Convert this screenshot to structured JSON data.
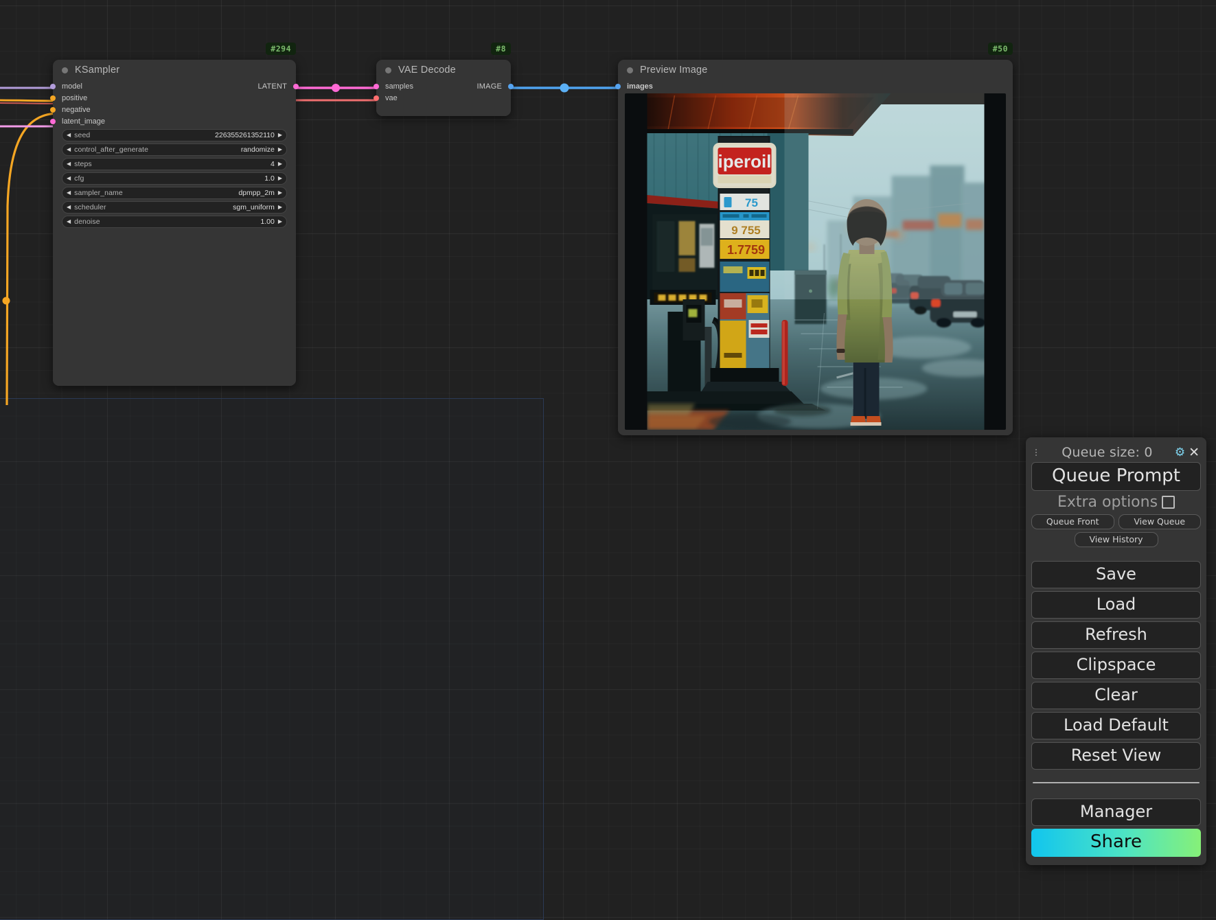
{
  "app": {
    "name": "ComfyUI",
    "canvas_bg": "#212121"
  },
  "nodes": [
    {
      "id": "ksampler",
      "badge": "#294",
      "title": "KSampler",
      "inputs": [
        {
          "label": "model",
          "color": "#b39ddb"
        },
        {
          "label": "positive",
          "color": "#f5a623"
        },
        {
          "label": "negative",
          "color": "#f5a623"
        },
        {
          "label": "latent_image",
          "color": "#ff6ad5"
        }
      ],
      "outputs": [
        {
          "label": "LATENT",
          "color": "#ff6ad5"
        }
      ],
      "widgets": [
        {
          "name": "seed",
          "value": "226355261352110"
        },
        {
          "name": "control_after_generate",
          "value": "randomize"
        },
        {
          "name": "steps",
          "value": "4"
        },
        {
          "name": "cfg",
          "value": "1.0"
        },
        {
          "name": "sampler_name",
          "value": "dpmpp_2m"
        },
        {
          "name": "scheduler",
          "value": "sgm_uniform"
        },
        {
          "name": "denoise",
          "value": "1.00"
        }
      ]
    },
    {
      "id": "vaedecode",
      "badge": "#8",
      "title": "VAE Decode",
      "inputs": [
        {
          "label": "samples",
          "color": "#ff6ad5"
        },
        {
          "label": "vae",
          "color": "#ff6f6f"
        }
      ],
      "outputs": [
        {
          "label": "IMAGE",
          "color": "#56a3ef"
        }
      ],
      "widgets": []
    },
    {
      "id": "previewimage",
      "badge": "#50",
      "title": "Preview Image",
      "inputs": [
        {
          "label": "images",
          "color": "#56a3ef"
        }
      ],
      "outputs": [],
      "widgets": []
    }
  ],
  "preview": {
    "alt": "Rainy dusk street: a person in an olive t-shirt and dark jeans with orange sneakers stands on wet pavement facing a lit gas station; cars parked along the misty road.",
    "station_sign": "iperoil",
    "price_rows": [
      "75",
      "9 755",
      "1.7759"
    ]
  },
  "menu": {
    "queue_size_label": "Queue size: 0",
    "gear_icon": "gear-icon",
    "close_icon": "close-icon",
    "queue_prompt": "Queue Prompt",
    "extra_options": "Extra options",
    "queue_front": "Queue Front",
    "view_queue": "View Queue",
    "view_history": "View History",
    "save": "Save",
    "load": "Load",
    "refresh": "Refresh",
    "clipspace": "Clipspace",
    "clear": "Clear",
    "load_default": "Load Default",
    "reset_view": "Reset View",
    "manager": "Manager",
    "share": "Share",
    "share_gradient_from": "#11c5ee",
    "share_gradient_to": "#86f078"
  }
}
